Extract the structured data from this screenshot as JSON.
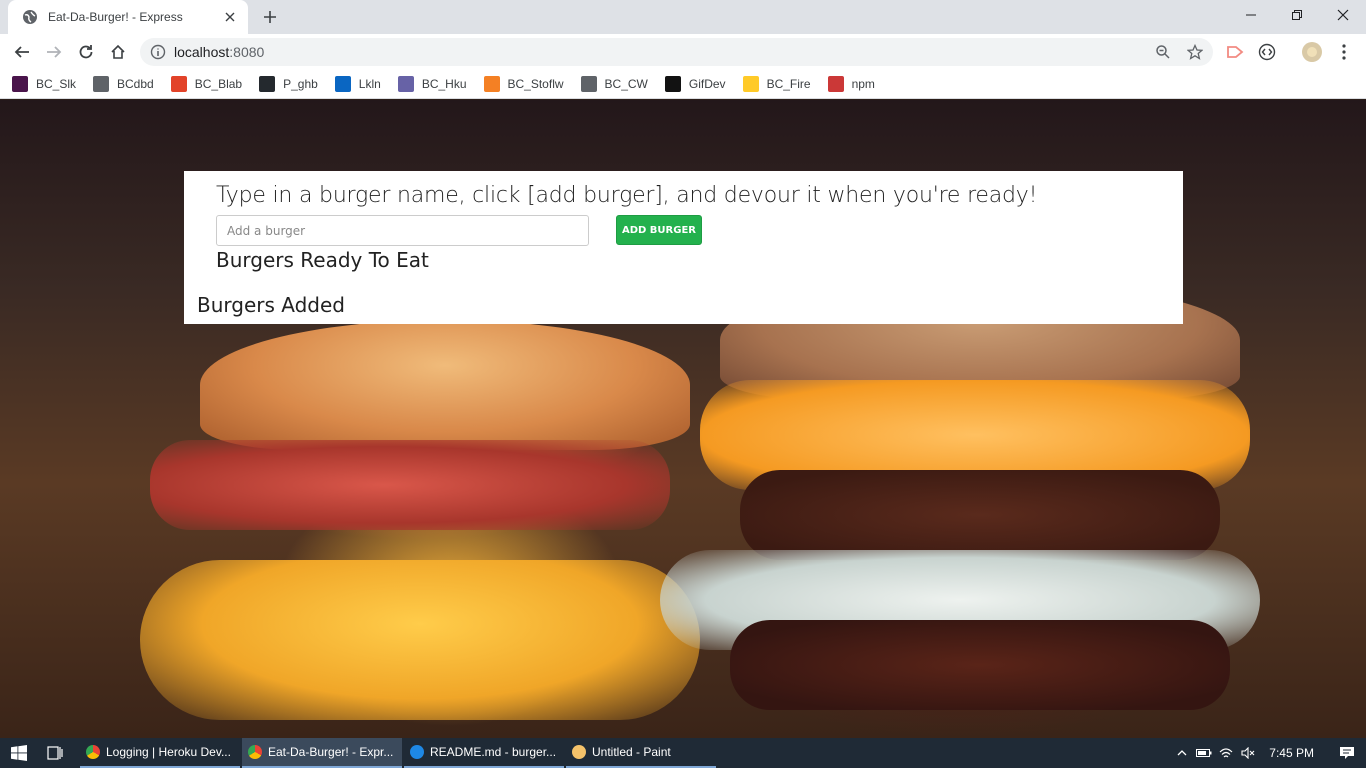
{
  "browser": {
    "tab": {
      "title": "Eat-Da-Burger! - Express",
      "favicon": "globe-icon"
    },
    "url": {
      "host": "localhost",
      "port": ":8080"
    },
    "bookmarks": [
      {
        "label": "BC_Slk",
        "icon": "slack-icon",
        "color": "#4a154b"
      },
      {
        "label": "BCdbd",
        "icon": "globe-icon",
        "color": "#5f6368"
      },
      {
        "label": "BC_Blab",
        "icon": "gitlab-icon",
        "color": "#e24329"
      },
      {
        "label": "P_ghb",
        "icon": "github-icon",
        "color": "#24292e"
      },
      {
        "label": "Lkln",
        "icon": "linkedin-icon",
        "color": "#0a66c2"
      },
      {
        "label": "BC_Hku",
        "icon": "heroku-icon",
        "color": "#6762a6"
      },
      {
        "label": "BC_Stoflw",
        "icon": "stackoverflow-icon",
        "color": "#f48024"
      },
      {
        "label": "BC_CW",
        "icon": "globe-icon",
        "color": "#5f6368"
      },
      {
        "label": "GifDev",
        "icon": "giphy-icon",
        "color": "#121212"
      },
      {
        "label": "BC_Fire",
        "icon": "firebase-icon",
        "color": "#ffca28"
      },
      {
        "label": "npm",
        "icon": "npm-icon",
        "color": "#cb3837"
      }
    ]
  },
  "page": {
    "instruction": "Type in a burger name, click [add burger], and devour it when you're ready!",
    "input_placeholder": "Add a burger",
    "add_button_label": "ADD BURGER",
    "ready_heading": "Burgers Ready To Eat",
    "added_heading": "Burgers Added",
    "accent_color": "#23b14d"
  },
  "taskbar": {
    "apps": [
      {
        "label": "Logging | Heroku Dev...",
        "icon": "chrome-icon",
        "active": false
      },
      {
        "label": "Eat-Da-Burger! - Expr...",
        "icon": "chrome-icon",
        "active": true
      },
      {
        "label": "README.md - burger...",
        "icon": "vscode-icon",
        "active": false
      },
      {
        "label": "Untitled - Paint",
        "icon": "paint-icon",
        "active": false
      }
    ],
    "clock": "7:45 PM"
  }
}
